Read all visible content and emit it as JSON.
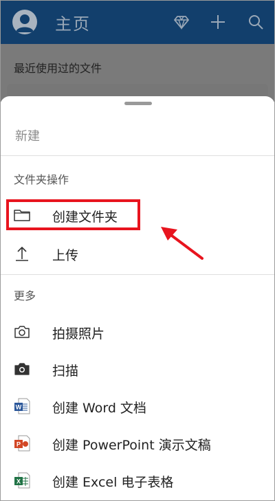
{
  "appbar": {
    "title": "主页",
    "icons": [
      "avatar",
      "diamond-icon",
      "plus-icon",
      "search-icon"
    ]
  },
  "background": {
    "recent_label": "最近使用过的文件"
  },
  "sheet": {
    "title": "新建",
    "folder_section": {
      "label": "文件夹操作",
      "items": [
        {
          "label": "创建文件夹",
          "icon": "folder-icon"
        },
        {
          "label": "上传",
          "icon": "upload-icon"
        }
      ]
    },
    "more_section": {
      "label": "更多",
      "items": [
        {
          "label": "拍摄照片",
          "icon": "camera-outline-icon"
        },
        {
          "label": "扫描",
          "icon": "camera-filled-icon"
        },
        {
          "label": "创建 Word 文档",
          "icon": "word-icon",
          "badge": "W",
          "color": "#2b579a"
        },
        {
          "label": "创建 PowerPoint 演示文稿",
          "icon": "powerpoint-icon",
          "badge": "P",
          "color": "#d24726"
        },
        {
          "label": "创建 Excel 电子表格",
          "icon": "excel-icon",
          "badge": "X",
          "color": "#217346"
        }
      ]
    }
  },
  "annotation": {
    "highlight_color": "#e8141e",
    "arrow_color": "#e8141e"
  }
}
